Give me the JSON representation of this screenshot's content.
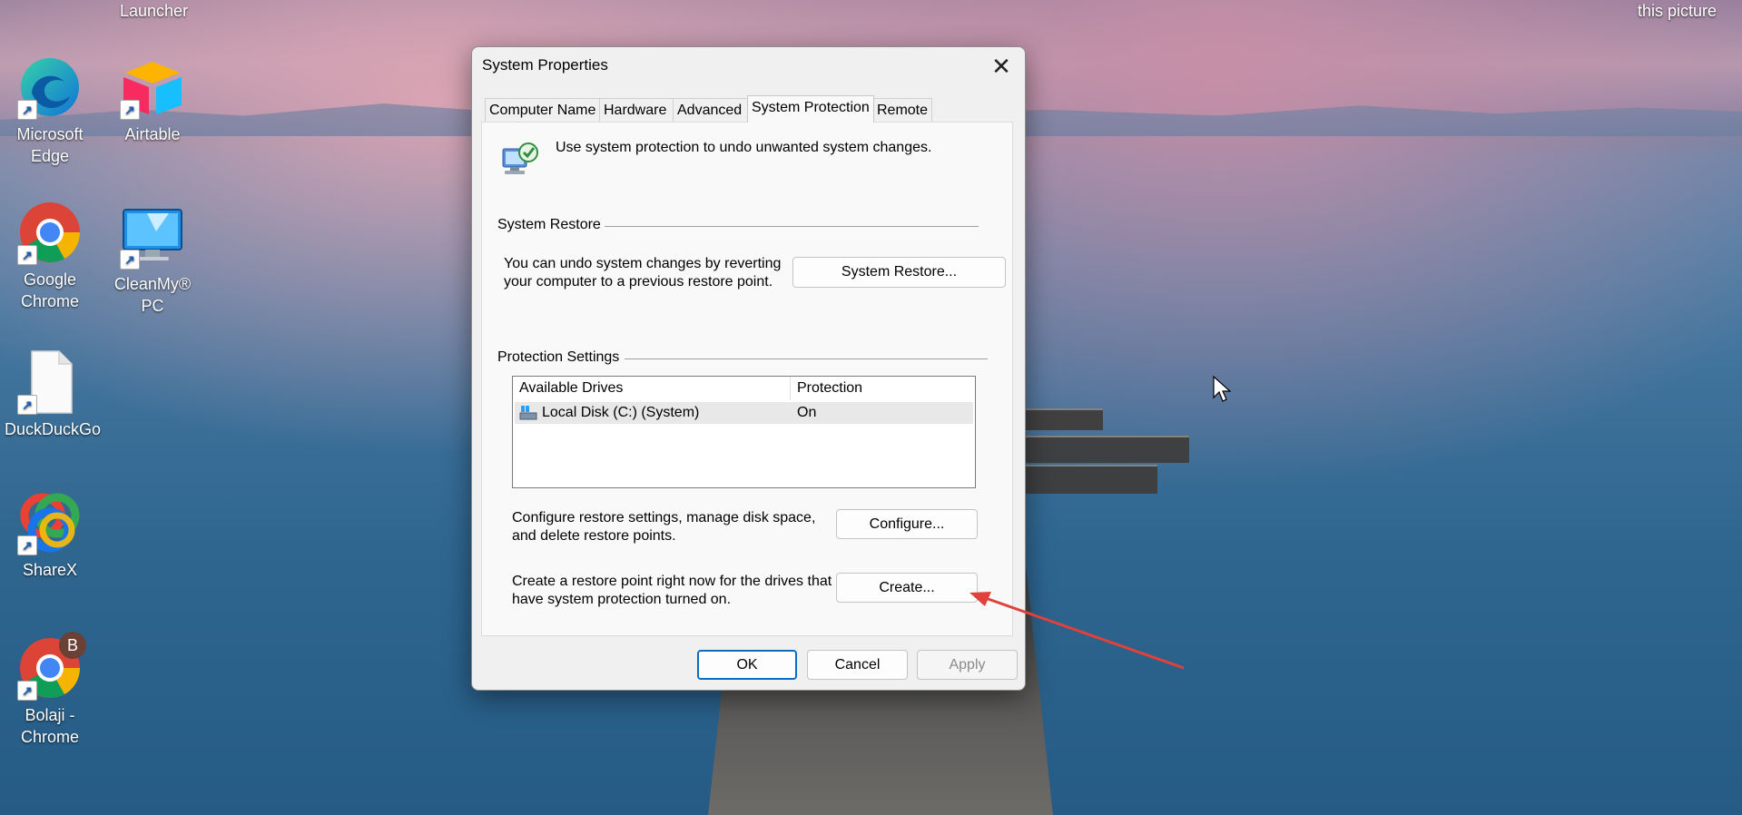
{
  "desktop": {
    "top_captions": {
      "left": "Launcher",
      "right": "this picture"
    },
    "icons": [
      {
        "label_line1": "Microsoft",
        "label_line2": "Edge"
      },
      {
        "label_line1": "Airtable",
        "label_line2": ""
      },
      {
        "label_line1": "Google",
        "label_line2": "Chrome"
      },
      {
        "label_line1": "CleanMy®",
        "label_line2": "PC"
      },
      {
        "label_line1": "DuckDuckGo",
        "label_line2": ""
      },
      {
        "label_line1": "ShareX",
        "label_line2": ""
      },
      {
        "label_line1": "Bolaji -",
        "label_line2": "Chrome",
        "badge": "B"
      }
    ]
  },
  "dialog": {
    "title": "System Properties",
    "close_glyph": "✕",
    "tabs": [
      "Computer Name",
      "Hardware",
      "Advanced",
      "System Protection",
      "Remote"
    ],
    "active_tab": "System Protection",
    "intro": "Use system protection to undo unwanted system changes.",
    "restore_group": {
      "title": "System Restore",
      "desc_line1": "You can undo system changes by reverting",
      "desc_line2": "your computer to a previous restore point.",
      "button": "System Restore..."
    },
    "protection_group": {
      "title": "Protection Settings",
      "columns": [
        "Available Drives",
        "Protection"
      ],
      "rows": [
        {
          "drive": "Local Disk (C:) (System)",
          "protection": "On"
        }
      ],
      "configure_line1": "Configure restore settings, manage disk space,",
      "configure_line2": "and delete restore points.",
      "configure_button": "Configure...",
      "create_line1": "Create a restore point right now for the drives that",
      "create_line2": "have system protection turned on.",
      "create_button": "Create..."
    },
    "footer": {
      "ok": "OK",
      "cancel": "Cancel",
      "apply": "Apply"
    }
  },
  "colors": {
    "annotation_arrow": "#e0413a",
    "default_button_border": "#0a6cc2"
  }
}
